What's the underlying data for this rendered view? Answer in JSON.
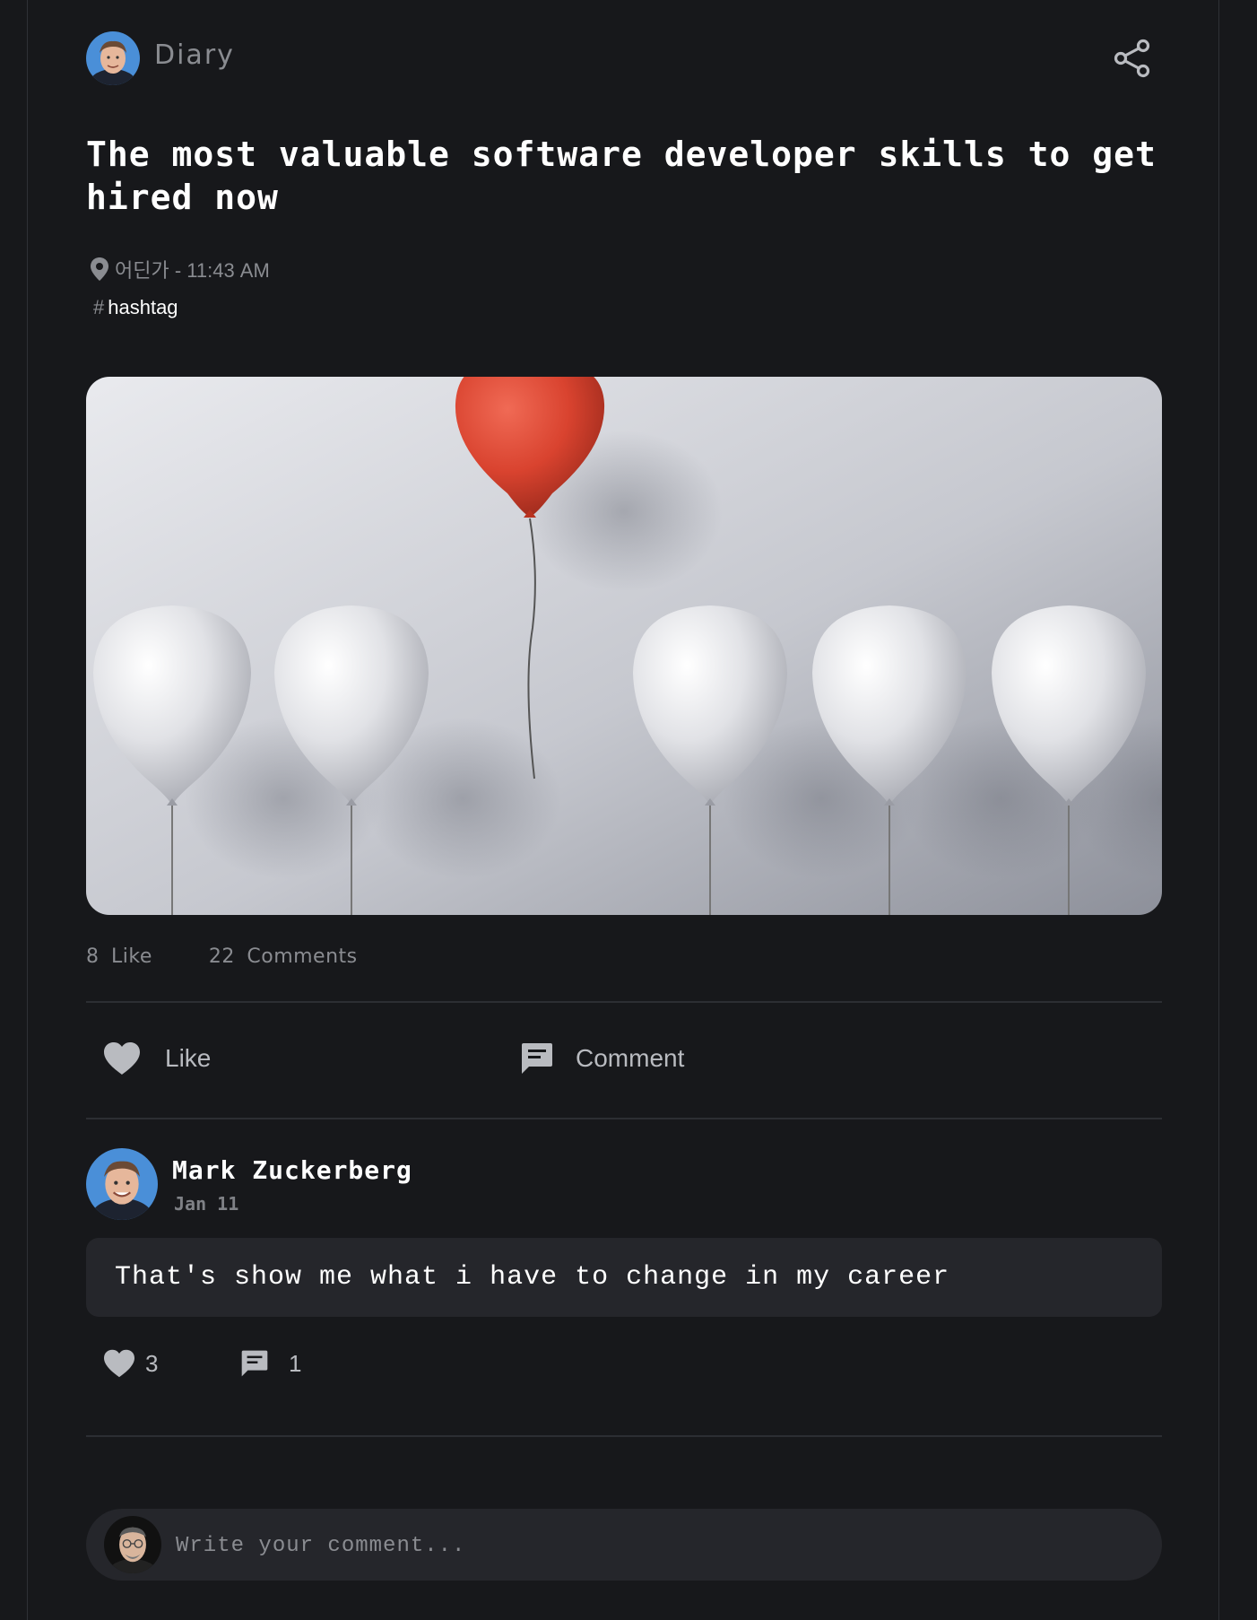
{
  "header": {
    "brand": "Diary",
    "share_icon": "share-icon"
  },
  "post": {
    "title": "The most valuable software developer skills to get hired now",
    "location": "어딘가 - 11:43 AM",
    "hashtag_symbol": "#",
    "hashtag": "hashtag",
    "image_alt": "one red balloon floating above a row of white balloons",
    "likes_count": "8",
    "likes_label": "Like",
    "comments_count": "22",
    "comments_label": "Comments"
  },
  "actions": {
    "like_label": "Like",
    "comment_label": "Comment"
  },
  "comment": {
    "author": "Mark Zuckerberg",
    "date": "Jan 11",
    "text": "That's show me what i have to change in my career",
    "likes": "3",
    "replies": "1"
  },
  "composer": {
    "placeholder": "Write your comment..."
  },
  "colors": {
    "background": "#17181b",
    "surface": "#25262b",
    "muted_text": "#8a8c91",
    "accent_red": "#d9432f"
  }
}
